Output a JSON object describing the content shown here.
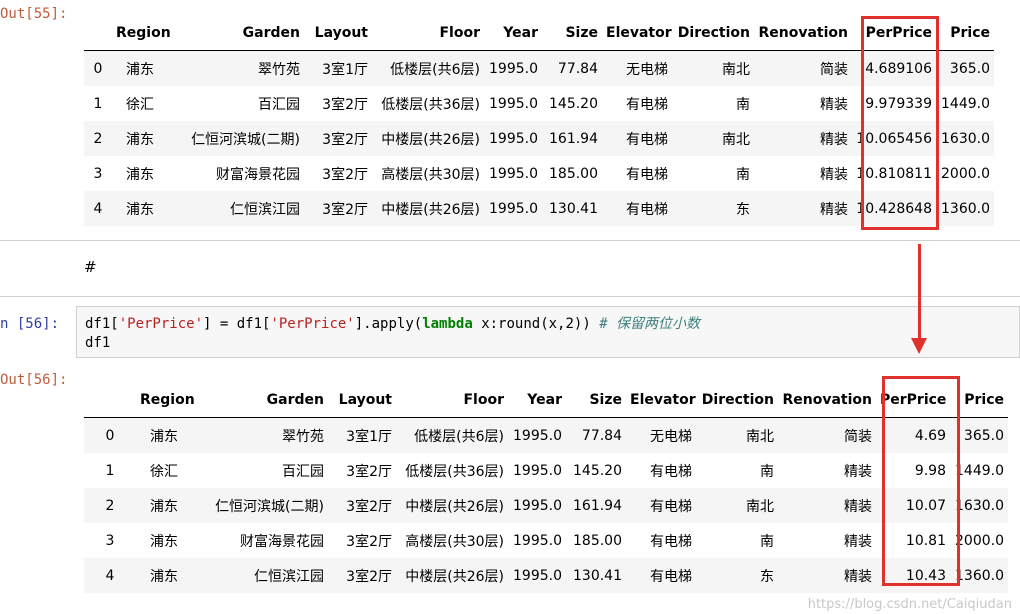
{
  "cell55": {
    "out_prompt": "Out[55]:",
    "columns": [
      "",
      "Region",
      "Garden",
      "Layout",
      "Floor",
      "Year",
      "Size",
      "Elevator",
      "Direction",
      "Renovation",
      "PerPrice",
      "Price"
    ],
    "rows": [
      [
        "0",
        "浦东",
        "翠竹苑",
        "3室1厅",
        "低楼层(共6层)",
        "1995.0",
        "77.84",
        "无电梯",
        "南北",
        "简装",
        "4.689106",
        "365.0"
      ],
      [
        "1",
        "徐汇",
        "百汇园",
        "3室2厅",
        "低楼层(共36层)",
        "1995.0",
        "145.20",
        "有电梯",
        "南",
        "精装",
        "9.979339",
        "1449.0"
      ],
      [
        "2",
        "浦东",
        "仁恒河滨城(二期)",
        "3室2厅",
        "中楼层(共26层)",
        "1995.0",
        "161.94",
        "有电梯",
        "南北",
        "精装",
        "10.065456",
        "1630.0"
      ],
      [
        "3",
        "浦东",
        "财富海景花园",
        "3室2厅",
        "高楼层(共30层)",
        "1995.0",
        "185.00",
        "有电梯",
        "南",
        "精装",
        "10.810811",
        "2000.0"
      ],
      [
        "4",
        "浦东",
        "仁恒滨江园",
        "3室2厅",
        "中楼层(共26层)",
        "1995.0",
        "130.41",
        "有电梯",
        "东",
        "精装",
        "10.428648",
        "1360.0"
      ]
    ]
  },
  "markdown_cell": {
    "text": "#"
  },
  "cell56": {
    "in_prompt": "n  [56]:",
    "code": {
      "line1_a": "df1[",
      "line1_str1": "'PerPrice'",
      "line1_b": "] = df1[",
      "line1_str2": "'PerPrice'",
      "line1_c": "].apply(",
      "line1_kw": "lambda",
      "line1_d": " x:round(x,2)) ",
      "line1_cmt": "# 保留两位小数",
      "line2": "df1"
    },
    "out_prompt": "Out[56]:",
    "columns": [
      "",
      "Region",
      "Garden",
      "Layout",
      "Floor",
      "Year",
      "Size",
      "Elevator",
      "Direction",
      "Renovation",
      "PerPrice",
      "Price"
    ],
    "rows": [
      [
        "0",
        "浦东",
        "翠竹苑",
        "3室1厅",
        "低楼层(共6层)",
        "1995.0",
        "77.84",
        "无电梯",
        "南北",
        "简装",
        "4.69",
        "365.0"
      ],
      [
        "1",
        "徐汇",
        "百汇园",
        "3室2厅",
        "低楼层(共36层)",
        "1995.0",
        "145.20",
        "有电梯",
        "南",
        "精装",
        "9.98",
        "1449.0"
      ],
      [
        "2",
        "浦东",
        "仁恒河滨城(二期)",
        "3室2厅",
        "中楼层(共26层)",
        "1995.0",
        "161.94",
        "有电梯",
        "南北",
        "精装",
        "10.07",
        "1630.0"
      ],
      [
        "3",
        "浦东",
        "财富海景花园",
        "3室2厅",
        "高楼层(共30层)",
        "1995.0",
        "185.00",
        "有电梯",
        "南",
        "精装",
        "10.81",
        "2000.0"
      ],
      [
        "4",
        "浦东",
        "仁恒滨江园",
        "3室2厅",
        "中楼层(共26层)",
        "1995.0",
        "130.41",
        "有电梯",
        "东",
        "精装",
        "10.43",
        "1360.0"
      ]
    ]
  },
  "annotation": {
    "highlight_color": "#e0312c",
    "highlighted_column": "PerPrice"
  },
  "watermark": "https://blog.csdn.net/Caiqiudan"
}
